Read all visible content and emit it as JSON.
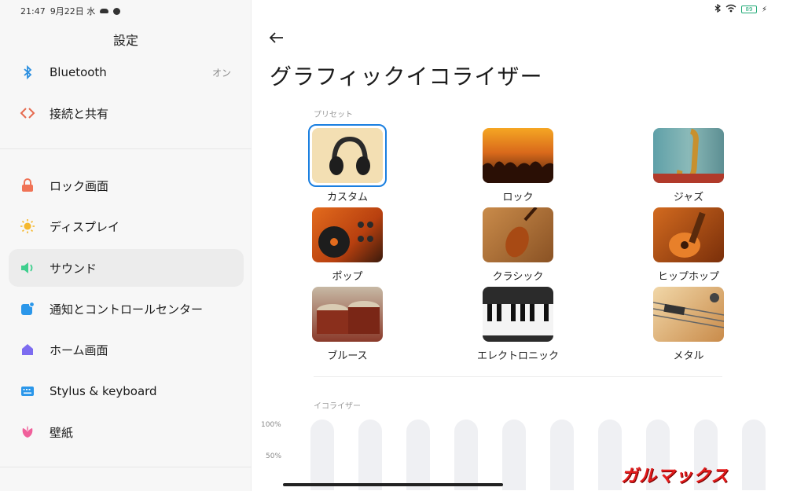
{
  "status": {
    "time": "21:47",
    "date": "9月22日 水",
    "battery": "89"
  },
  "settings": {
    "title": "設定"
  },
  "menu": [
    {
      "label": "Bluetooth",
      "value": "オン",
      "icon": "bluetooth-icon"
    },
    {
      "label": "接続と共有",
      "icon": "share-icon"
    },
    {
      "label": "ロック画面",
      "icon": "lock-icon"
    },
    {
      "label": "ディスプレイ",
      "icon": "sun-icon"
    },
    {
      "label": "サウンド",
      "icon": "speaker-icon"
    },
    {
      "label": "通知とコントロールセンター",
      "icon": "notification-icon"
    },
    {
      "label": "ホーム画面",
      "icon": "home-icon"
    },
    {
      "label": "Stylus & keyboard",
      "icon": "keyboard-icon"
    },
    {
      "label": "壁紙",
      "icon": "flower-icon"
    }
  ],
  "page": {
    "title": "グラフィックイコライザー"
  },
  "presets_label": "プリセット",
  "presets": [
    {
      "label": "カスタム"
    },
    {
      "label": "ロック"
    },
    {
      "label": "ジャズ"
    },
    {
      "label": "ポップ"
    },
    {
      "label": "クラシック"
    },
    {
      "label": "ヒップホップ"
    },
    {
      "label": "ブルース"
    },
    {
      "label": "エレクトロニック"
    },
    {
      "label": "メタル"
    }
  ],
  "equalizer": {
    "label": "イコライザー",
    "axis_top": "100%",
    "axis_mid": "50%",
    "band_count": 10
  },
  "watermark": "ガルマックス"
}
